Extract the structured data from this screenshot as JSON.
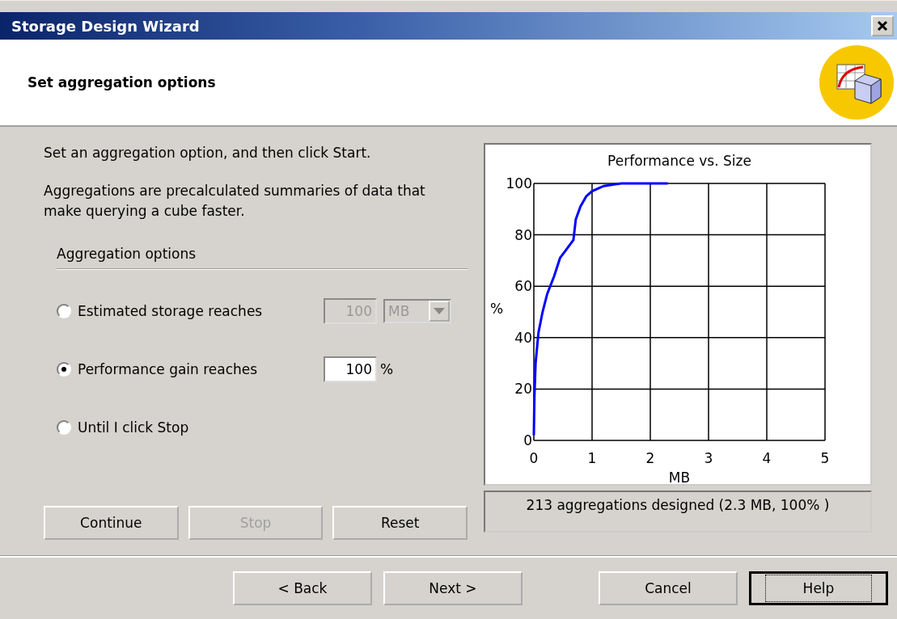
{
  "window": {
    "title": "Storage Design Wizard"
  },
  "header": {
    "title": "Set aggregation options"
  },
  "instructions": [
    "Set an aggregation option, and then click Start.",
    "Aggregations are precalculated summaries of data that make querying a cube faster."
  ],
  "options_group": {
    "title": "Aggregation options",
    "options": [
      {
        "kind": "storage",
        "label": "Estimated storage reaches",
        "selected": false,
        "value": "100",
        "unit": "MB",
        "disabled": true
      },
      {
        "kind": "gain",
        "label": "Performance gain reaches",
        "selected": true,
        "value": "100",
        "suffix": "%",
        "disabled": false
      },
      {
        "kind": "manual",
        "label": "Until I click Stop",
        "selected": false
      }
    ]
  },
  "action_buttons": [
    {
      "label": "Continue",
      "disabled": false
    },
    {
      "label": "Stop",
      "disabled": true
    },
    {
      "label": "Reset",
      "disabled": false
    }
  ],
  "chart": {
    "chart_data": {
      "type": "line",
      "title": "Performance vs. Size",
      "xlabel": "MB",
      "ylabel": "%",
      "x": [
        0,
        0.01,
        0.03,
        0.08,
        0.15,
        0.23,
        0.35,
        0.45,
        0.55,
        0.68,
        0.72,
        0.8,
        0.9,
        1.0,
        1.2,
        1.5,
        2.3
      ],
      "series": [
        {
          "color": "#0000ff",
          "values": [
            2,
            17,
            30,
            42,
            50,
            57,
            64,
            71,
            74,
            78,
            86,
            91,
            95,
            97,
            99,
            100,
            100
          ]
        }
      ],
      "xlim": [
        0,
        5
      ],
      "ylim": [
        0,
        100
      ],
      "xticks": [
        0,
        1,
        2,
        3,
        4,
        5
      ],
      "yticks": [
        0,
        20,
        40,
        60,
        80,
        100
      ],
      "grid": true
    }
  },
  "status": "213 aggregations designed (2.3 MB, 100% )",
  "nav_buttons": [
    {
      "label": "< Back",
      "focused": false
    },
    {
      "label": "Next >",
      "focused": false
    },
    {
      "label": "Cancel",
      "focused": false
    },
    {
      "label": "Help",
      "focused": true
    }
  ]
}
